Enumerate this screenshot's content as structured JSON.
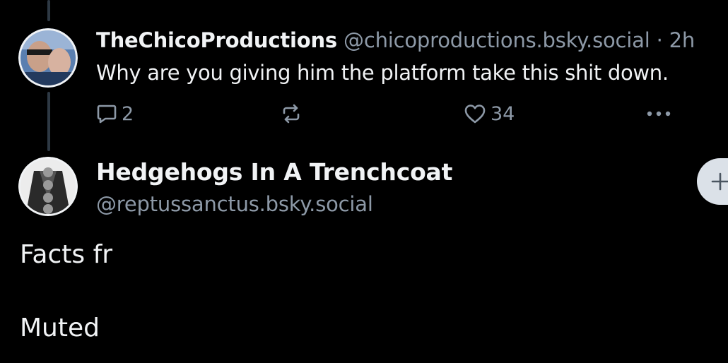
{
  "reply_post": {
    "author_name": "TheChicoProductions",
    "author_handle": "@chicoproductions.bsky.social",
    "separator": "·",
    "time_ago": "2h",
    "text": "Why are you giving him the platform take this shit down.",
    "reply_count": "2",
    "like_count": "34",
    "avatar_icon": "user-photo-avatar"
  },
  "main_post": {
    "author_name": "Hedgehogs In A Trenchcoat",
    "author_handle": "@reptussanctus.bsky.social",
    "avatar_icon": "trenchcoat-hedgehogs-avatar",
    "text_lines": [
      "Facts fr",
      "Muted"
    ]
  },
  "icons": {
    "reply": "reply-icon",
    "repost": "repost-icon",
    "like": "like-icon",
    "more": "more-icon",
    "follow": "plus-icon"
  },
  "colors": {
    "background": "#000000",
    "primary_text": "#f1f3f5",
    "secondary_text": "#8d99a7",
    "thread_line": "#2e3944",
    "follow_button": "#dbe1e8"
  }
}
